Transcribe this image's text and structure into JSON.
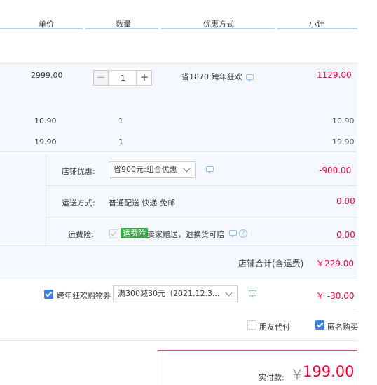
{
  "header": {
    "unit_price": "单价",
    "quantity": "数量",
    "discount_method": "优惠方式",
    "subtotal": "小计"
  },
  "main_item": {
    "price": "2999.00",
    "quantity": "1",
    "qty_minus": "−",
    "qty_plus": "+",
    "promo": "省1870:跨年狂欢",
    "subtotal": "1129.00"
  },
  "gift_items": [
    {
      "price": "10.90",
      "quantity": "1",
      "subtotal": "10.90"
    },
    {
      "price": "19.90",
      "quantity": "1",
      "subtotal": "19.90"
    }
  ],
  "shop": {
    "discount_label": "店铺优惠:",
    "discount_select": "省900元:组合优惠",
    "discount_amount": "-900.00",
    "shipping_label": "运送方式:",
    "shipping_value": "普通配送 快递 免邮",
    "shipping_amount": "0.00",
    "insurance_label": "运费险:",
    "insurance_tag": "运费险",
    "insurance_text": "卖家赠送，退换货可赔",
    "insurance_amount": "0.00",
    "total_label": "店铺合计(含运费)",
    "total_amount": "￥229.00"
  },
  "coupon": {
    "label": "跨年狂欢购物券",
    "select": "满300减30元（2021.12.3...",
    "amount": "￥ -30.00"
  },
  "options": {
    "friend_pay": "朋友代付",
    "anonymous": "匿名购买"
  },
  "payment": {
    "label": "实付款:",
    "currency": "￥",
    "amount": "199.00"
  },
  "colors": {
    "accent_blue": "#3a7fe4",
    "price_red": "#ff0036",
    "band_bg": "#f5f8fe",
    "insurance_green": "#3fa84a"
  }
}
